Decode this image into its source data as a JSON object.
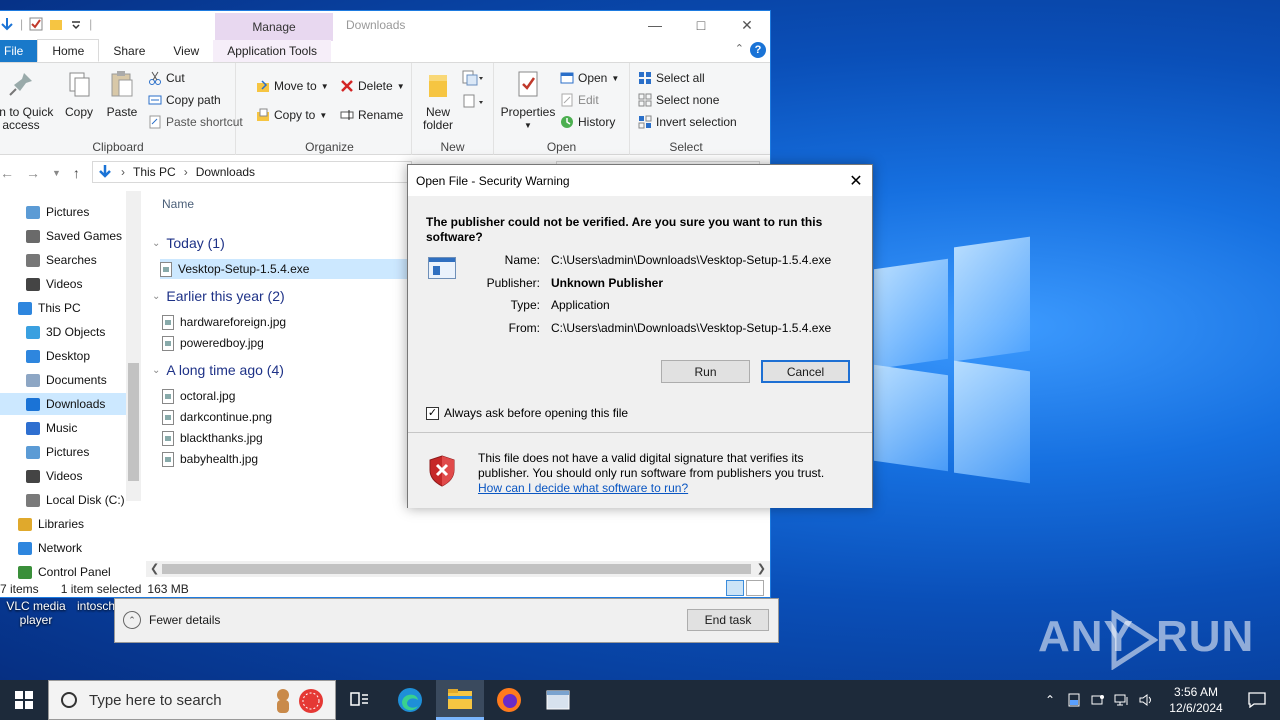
{
  "desktop": {
    "icons": [
      {
        "label": "VLC media player"
      },
      {
        "label": "intosch"
      }
    ],
    "watermark": {
      "left": "ANY",
      "right": "RUN"
    }
  },
  "task_manager": {
    "fewer_details": "Fewer details",
    "end_task": "End task"
  },
  "explorer": {
    "title": "Downloads",
    "contextual_tab": "Manage",
    "tabs": [
      "File",
      "Home",
      "Share",
      "View",
      "Application Tools"
    ],
    "ribbon": {
      "clipboard": {
        "label": "Clipboard",
        "pin": "Pin to Quick access",
        "copy": "Copy",
        "paste": "Paste",
        "cut": "Cut",
        "copy_path": "Copy path",
        "paste_shortcut": "Paste shortcut"
      },
      "organize": {
        "label": "Organize",
        "move_to": "Move to",
        "copy_to": "Copy to",
        "delete": "Delete",
        "rename": "Rename"
      },
      "new": {
        "label": "New",
        "new_folder": "New folder"
      },
      "open": {
        "label": "Open",
        "properties": "Properties",
        "open": "Open",
        "edit": "Edit",
        "history": "History"
      },
      "select": {
        "label": "Select",
        "select_all": "Select all",
        "select_none": "Select none",
        "invert": "Invert selection"
      }
    },
    "address": {
      "crumbs": [
        "This PC",
        "Downloads"
      ]
    },
    "nav": [
      {
        "label": "Pictures",
        "icon": "pictures-icon"
      },
      {
        "label": "Saved Games",
        "icon": "saved-games-icon"
      },
      {
        "label": "Searches",
        "icon": "searches-icon"
      },
      {
        "label": "Videos",
        "icon": "videos-icon"
      },
      {
        "label": "This PC",
        "icon": "this-pc-icon"
      },
      {
        "label": "3D Objects",
        "icon": "3d-objects-icon"
      },
      {
        "label": "Desktop",
        "icon": "desktop-icon"
      },
      {
        "label": "Documents",
        "icon": "documents-icon"
      },
      {
        "label": "Downloads",
        "icon": "downloads-icon"
      },
      {
        "label": "Music",
        "icon": "music-icon"
      },
      {
        "label": "Pictures",
        "icon": "pictures-icon"
      },
      {
        "label": "Videos",
        "icon": "videos-icon"
      },
      {
        "label": "Local Disk (C:)",
        "icon": "local-disk-icon"
      },
      {
        "label": "Libraries",
        "icon": "libraries-icon"
      },
      {
        "label": "Network",
        "icon": "network-icon"
      },
      {
        "label": "Control Panel",
        "icon": "control-panel-icon"
      }
    ],
    "column_name": "Name",
    "groups": [
      {
        "header": "Today (1)",
        "files": [
          "Vesktop-Setup-1.5.4.exe"
        ]
      },
      {
        "header": "Earlier this year (2)",
        "files": [
          "hardwareforeign.jpg",
          "poweredboy.jpg"
        ]
      },
      {
        "header": "A long time ago (4)",
        "files": [
          "octoral.jpg",
          "darkcontinue.png",
          "blackthanks.jpg",
          "babyhealth.jpg"
        ]
      }
    ],
    "status": {
      "items": "7 items",
      "selected": "1 item selected",
      "size": "163 MB"
    }
  },
  "dialog": {
    "title": "Open File - Security Warning",
    "question": "The publisher could not be verified.  Are you sure you want to run this software?",
    "fields": [
      {
        "label": "Name:",
        "value": "C:\\Users\\admin\\Downloads\\Vesktop-Setup-1.5.4.exe"
      },
      {
        "label": "Publisher:",
        "value": "Unknown Publisher"
      },
      {
        "label": "Type:",
        "value": "Application"
      },
      {
        "label": "From:",
        "value": "C:\\Users\\admin\\Downloads\\Vesktop-Setup-1.5.4.exe"
      }
    ],
    "run": "Run",
    "cancel": "Cancel",
    "checkbox_label": "Always ask before opening this file",
    "checkbox_checked": true,
    "warning_text": "This file does not have a valid digital signature that verifies its publisher.  You should only run software from publishers you trust.",
    "help_link": "How can I decide what software to run?"
  },
  "taskbar": {
    "search_placeholder": "Type here to search",
    "time": "3:56 AM",
    "date": "12/6/2024"
  },
  "colors": {
    "accent": "#1979ca",
    "selection": "#cce8ff",
    "link": "#0a56c2",
    "taskbar": "#1d2a3a"
  }
}
